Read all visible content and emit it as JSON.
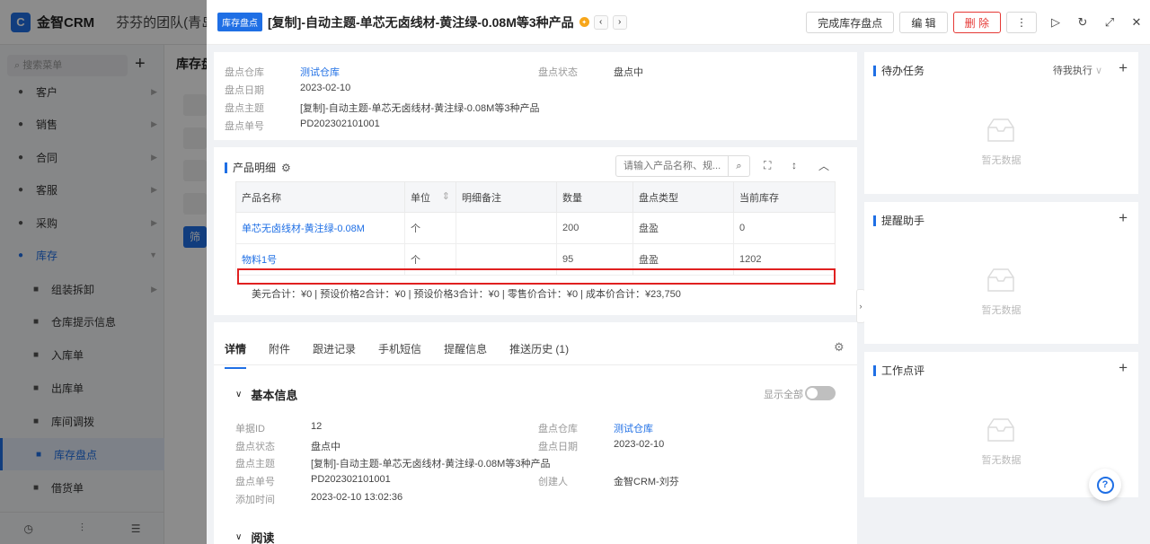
{
  "app": {
    "logo_mark": "C",
    "logo_text": "金智CRM",
    "team_name": "芬芬的团队(青岛"
  },
  "sidebar": {
    "search_placeholder": "搜索菜单",
    "items": [
      {
        "icon": "customer-icon",
        "label": "客户"
      },
      {
        "icon": "sales-icon",
        "label": "销售"
      },
      {
        "icon": "contract-icon",
        "label": "合同"
      },
      {
        "icon": "service-icon",
        "label": "客服"
      },
      {
        "icon": "purchase-icon",
        "label": "采购"
      },
      {
        "icon": "inventory-icon",
        "label": "库存"
      },
      {
        "icon": "assemble-icon",
        "label": "组装拆卸"
      },
      {
        "icon": "warehouse-alert-icon",
        "label": "仓库提示信息"
      },
      {
        "icon": "inbound-icon",
        "label": "入库单"
      },
      {
        "icon": "outbound-icon",
        "label": "出库单"
      },
      {
        "icon": "transfer-icon",
        "label": "库间调拨"
      },
      {
        "icon": "stocktake-icon",
        "label": "库存盘点"
      },
      {
        "icon": "borrow-icon",
        "label": "借货单"
      }
    ]
  },
  "background": {
    "page_title": "库存盘",
    "filter_button": "筛"
  },
  "drawer": {
    "tag": "库存盘点",
    "title": "[复制]-自动主题-单芯无卤线材-黄注绿-0.08M等3种产品",
    "actions": {
      "complete": "完成库存盘点",
      "edit": "编 辑",
      "delete": "删 除",
      "more": "⋮"
    }
  },
  "summary": {
    "warehouse_label": "盘点仓库",
    "warehouse_value": "测试仓库",
    "status_label": "盘点状态",
    "status_value": "盘点中",
    "date_label": "盘点日期",
    "date_value": "2023-02-10",
    "subject_label": "盘点主题",
    "subject_value": "[复制]-自动主题-单芯无卤线材-黄注绿-0.08M等3种产品",
    "number_label": "盘点单号",
    "number_value": "PD202302101001"
  },
  "products": {
    "title": "产品明细",
    "search_placeholder": "请输入产品名称、规...",
    "columns": [
      "产品名称",
      "单位",
      "明细备注",
      "数量",
      "盘点类型",
      "当前库存"
    ],
    "rows": [
      {
        "name": "单芯无卤线材-黄注绿-0.08M",
        "unit": "个",
        "note": "",
        "qty": "200",
        "type": "盘盈",
        "stock": "0"
      },
      {
        "name": "物料1号",
        "unit": "个",
        "note": "",
        "qty": "95",
        "type": "盘盈",
        "stock": "1202"
      }
    ],
    "totals": "美元合计：¥0 |   预设价格2合计：¥0 |   预设价格3合计：¥0 |   零售价合计：¥0 |   成本价合计：¥23,750"
  },
  "tabs": [
    "详情",
    "附件",
    "跟进记录",
    "手机短信",
    "提醒信息",
    "推送历史 (1)"
  ],
  "basic_info": {
    "title": "基本信息",
    "show_all": "显示全部",
    "fields": {
      "id_label": "单据ID",
      "id_value": "12",
      "status_label": "盘点状态",
      "status_value": "盘点中",
      "subject_label": "盘点主题",
      "subject_value": "[复制]-自动主题-单芯无卤线材-黄注绿-0.08M等3种产品",
      "number_label": "盘点单号",
      "number_value": "PD202302101001",
      "added_label": "添加时间",
      "added_value": "2023-02-10 13:02:36",
      "warehouse_label": "盘点仓库",
      "warehouse_value": "测试仓库",
      "date_label": "盘点日期",
      "date_value": "2023-02-10",
      "creator_label": "创建人",
      "creator_value": "金智CRM-刘芬"
    }
  },
  "read_section": {
    "title": "阅读"
  },
  "right_panels": {
    "todo": {
      "title": "待办任务",
      "filter": "待我执行",
      "empty": "暂无数据"
    },
    "reminder": {
      "title": "提醒助手",
      "empty": "暂无数据"
    },
    "comment": {
      "title": "工作点评",
      "empty": "暂无数据"
    }
  },
  "help": "?"
}
